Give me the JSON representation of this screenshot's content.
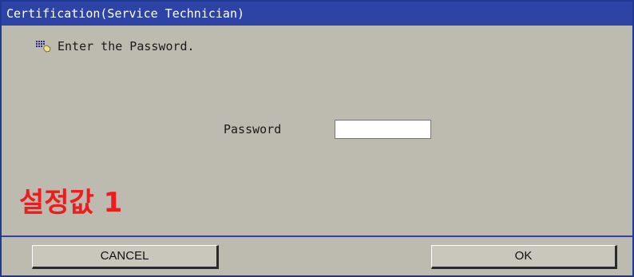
{
  "window": {
    "title": "Certification(Service Technician)"
  },
  "prompt": {
    "icon": "keypad-hand-icon",
    "text": "Enter the Password."
  },
  "password": {
    "label": "Password",
    "value": ""
  },
  "overlay": {
    "text": "설정값 1",
    "color": "#ee1c1c"
  },
  "buttons": {
    "cancel_label": "CANCEL",
    "ok_label": "OK"
  },
  "colors": {
    "title_bar": "#2d43a6",
    "dialog_background": "#bdbab0"
  }
}
